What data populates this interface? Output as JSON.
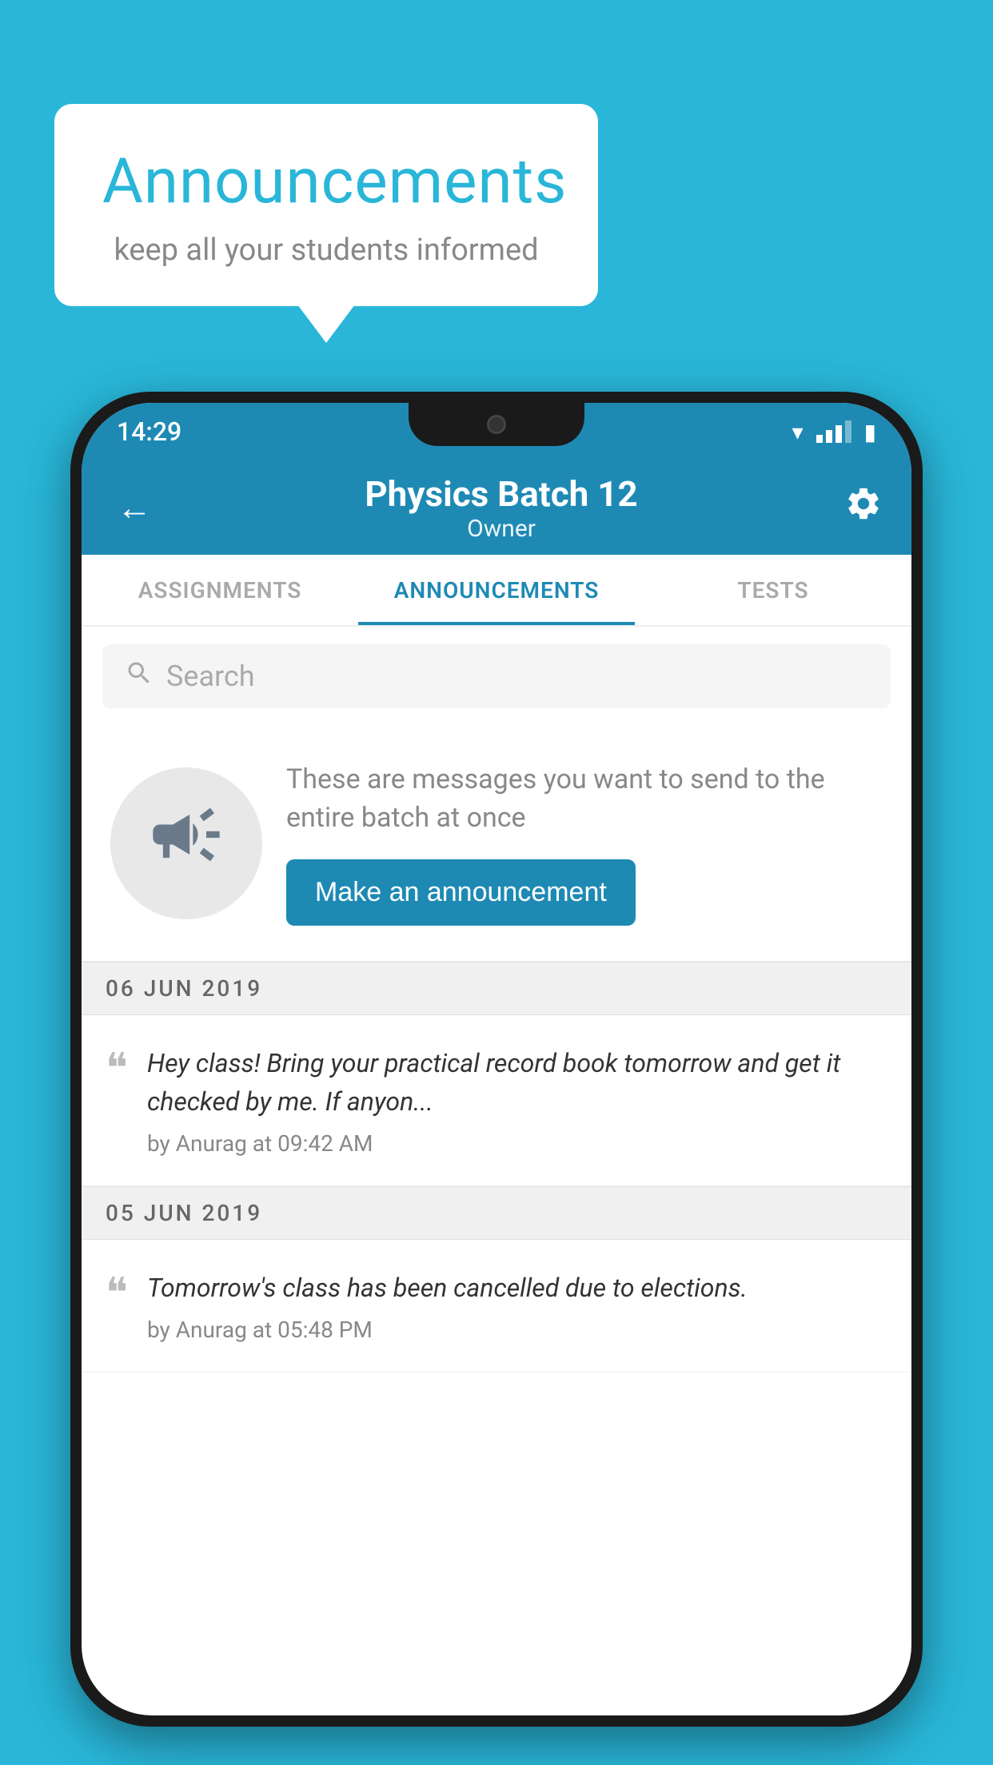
{
  "background_color": "#29b6d8",
  "speech_bubble": {
    "title": "Announcements",
    "subtitle": "keep all your students informed"
  },
  "phone": {
    "status_bar": {
      "time": "14:29"
    },
    "app_bar": {
      "title": "Physics Batch 12",
      "subtitle": "Owner",
      "back_label": "←",
      "settings_label": "⚙"
    },
    "tabs": [
      {
        "label": "ASSIGNMENTS",
        "active": false
      },
      {
        "label": "ANNOUNCEMENTS",
        "active": true
      },
      {
        "label": "TESTS",
        "active": false
      }
    ],
    "search": {
      "placeholder": "Search"
    },
    "empty_state": {
      "description": "These are messages you want to send to the entire batch at once",
      "cta_button": "Make an announcement"
    },
    "announcements": [
      {
        "date": "06  JUN  2019",
        "text": "Hey class! Bring your practical record book tomorrow and get it checked by me. If anyon...",
        "meta": "by Anurag at 09:42 AM"
      },
      {
        "date": "05  JUN  2019",
        "text": "Tomorrow's class has been cancelled due to elections.",
        "meta": "by Anurag at 05:48 PM"
      }
    ]
  }
}
